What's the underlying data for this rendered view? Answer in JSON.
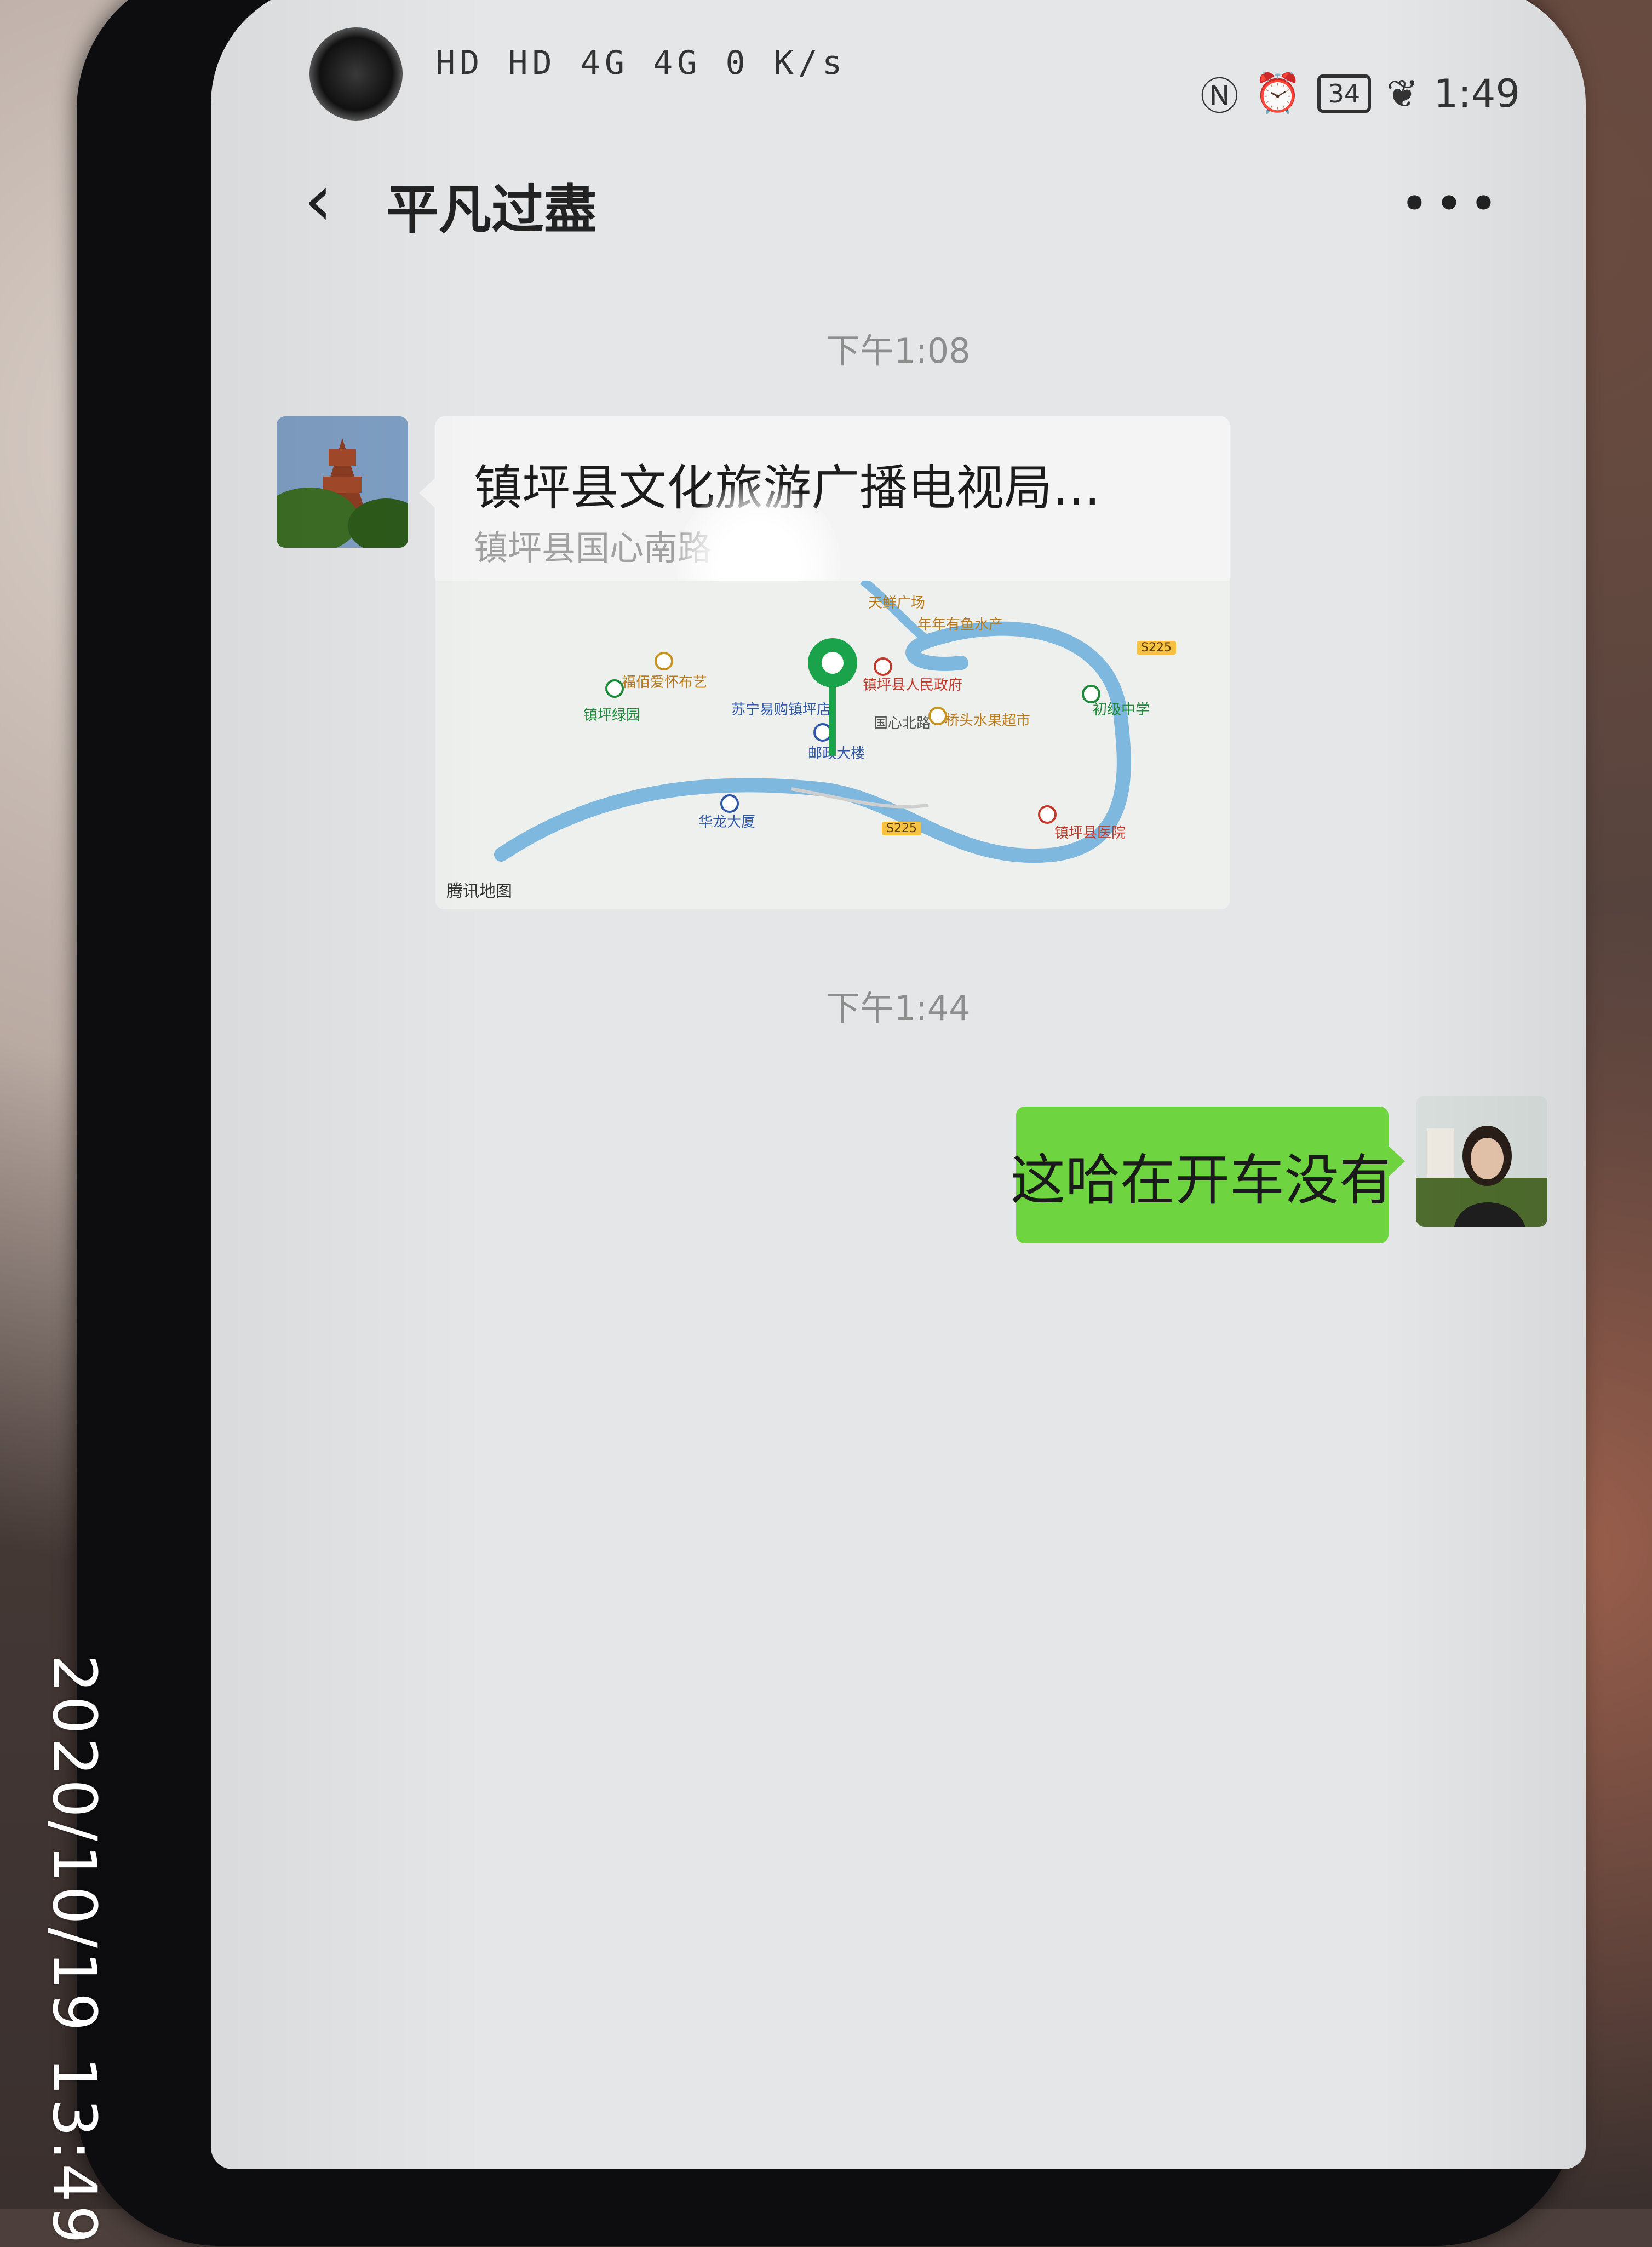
{
  "status_bar": {
    "left_indicators": "HD HD 4G 4G 0 K/s",
    "time": "1:49",
    "battery": "34"
  },
  "header": {
    "back_icon": "chevron-left-icon",
    "title": "平凡过盡",
    "more_icon": "more-dots-icon"
  },
  "messages": {
    "timestamp_1": "下午1:08",
    "location": {
      "title": "镇坪县文化旅游广播电视局…",
      "address": "镇坪县国心南路"
    },
    "timestamp_2": "下午1:44",
    "sent_text": "这哈在开车没有"
  },
  "map": {
    "brand": "腾讯地图",
    "labels": {
      "plaza": "天鲜广场",
      "aquatic": "年年有鱼水产",
      "gov": "镇坪县人民政府",
      "clothing": "福佰爱怀布艺",
      "park": "镇坪绿园",
      "suning": "苏宁易购镇坪店",
      "road": "国心北路",
      "post": "邮政大楼",
      "bridge_mart": "桥头水果超市",
      "school": "初级中学",
      "hualong": "华龙大厦",
      "hospital": "镇坪县医院",
      "s225_a": "S225",
      "s225_b": "S225"
    }
  },
  "photo_stamp": "2020/10/19  13:49",
  "colors": {
    "sent_bubble": "#6ed43f",
    "chat_bg": "#e5e6e7",
    "pin_green": "#1aa34a",
    "river_blue": "#7fb8de"
  }
}
